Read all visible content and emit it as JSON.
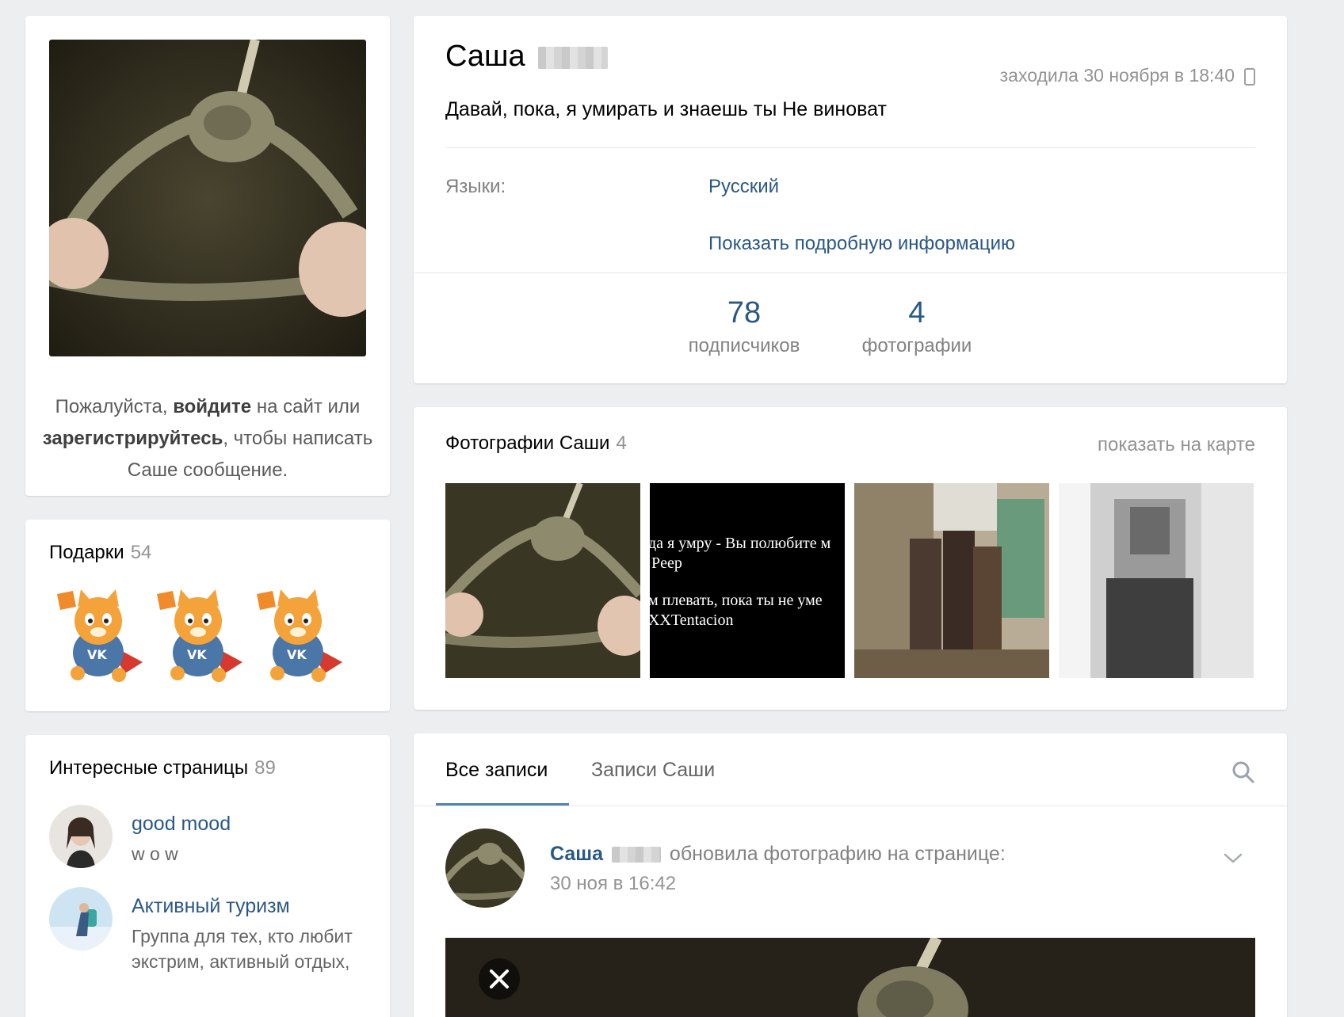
{
  "profile": {
    "name": "Саша",
    "last_seen": "заходила 30 ноября в 18:40",
    "status": "Давай, пока, я умирать и знаешь ты Не виноват",
    "languages_label": "Языки:",
    "languages_value": "Русский",
    "show_more": "Показать подробную информацию",
    "followers_count": "78",
    "followers_label": "подписчиков",
    "photos_count": "4",
    "photos_label": "фотографии"
  },
  "login_prompt": {
    "part1": "Пожалуйста, ",
    "login": "войдите",
    "part2": " на сайт или ",
    "register": "зарегистрируйтесь",
    "part3": ", чтобы написать Саше сообщение."
  },
  "gifts": {
    "title": "Подарки",
    "count": "54"
  },
  "pages": {
    "title": "Интересные страницы",
    "count": "89",
    "items": [
      {
        "name": "good mood",
        "desc": "w o w"
      },
      {
        "name": "Активный туризм",
        "desc": "Группа для тех, кто любит экстрим, активный отдых,"
      }
    ]
  },
  "photos": {
    "title": "Фотографии Саши",
    "count": "4",
    "map_link": "показать на карте",
    "text_photo": {
      "line1": "да я умру - Вы полюбите м",
      "line2": "Peep",
      "line3": "м плевать, пока ты не уме",
      "line4": "XXTentacion"
    }
  },
  "wall": {
    "tab_all": "Все записи",
    "tab_own": "Записи Саши",
    "post": {
      "author": "Саша",
      "action": "обновила фотографию на странице:",
      "time": "30 ноя в 16:42"
    }
  },
  "icons": {
    "search": "search-icon",
    "phone": "phone-icon",
    "chevron": "chevron-down-icon",
    "close": "close-icon"
  },
  "colors": {
    "link": "#2a5885",
    "accent": "#5181b8",
    "background": "#edeef0"
  }
}
